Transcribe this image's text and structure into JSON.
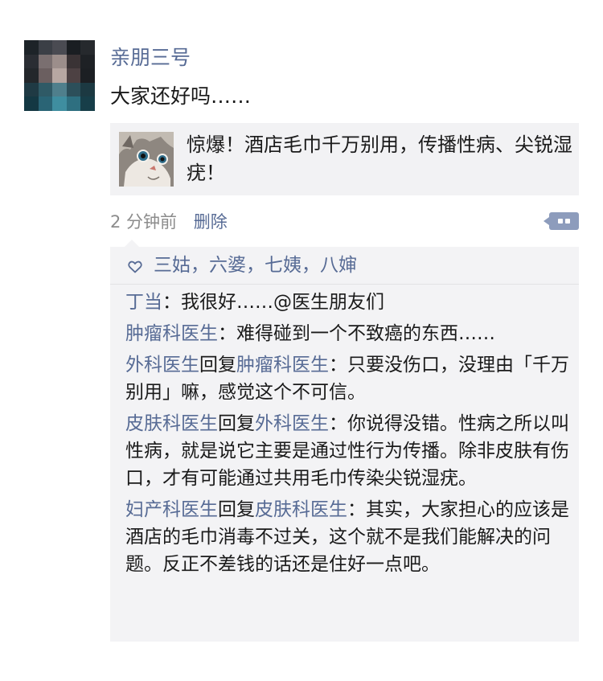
{
  "post": {
    "author": "亲朋三号",
    "text": "大家还好吗……",
    "link_title": "惊爆！酒店毛巾千万别用，传播性病、尖锐湿疣！",
    "time": "2 分钟前",
    "delete_label": "删除"
  },
  "likes": {
    "names": [
      "三姑",
      "六婆",
      "七姨",
      "八婶"
    ],
    "separator": "，"
  },
  "comments": [
    {
      "author": "丁当",
      "reply_word": "",
      "reply_to": "",
      "colon": "：",
      "text": "我很好……@医生朋友们"
    },
    {
      "author": "肿瘤科医生",
      "reply_word": "",
      "reply_to": "",
      "colon": "：",
      "text": "难得碰到一个不致癌的东西……"
    },
    {
      "author": "外科医生",
      "reply_word": "回复",
      "reply_to": "肿瘤科医生",
      "colon": "：",
      "text": "只要没伤口，没理由「千万别用」嘛，感觉这个不可信。"
    },
    {
      "author": "皮肤科医生",
      "reply_word": "回复",
      "reply_to": "外科医生",
      "colon": "：",
      "text": "你说得没错。性病之所以叫性病，就是说它主要是通过性行为传播。除非皮肤有伤口，才有可能通过共用毛巾传染尖锐湿疣。"
    },
    {
      "author": "妇产科医生",
      "reply_word": "回复",
      "reply_to": "皮肤科医生",
      "colon": "：",
      "text": "其实，大家担心的应该是酒店的毛巾消毒不过关，这个就不是我们能解决的问题。反正不差钱的话还是住好一点吧。"
    }
  ],
  "icons": {
    "heart": "heart-outline-icon",
    "comment_button": "more-actions-icon"
  },
  "colors": {
    "link_name": "#576b95",
    "time_gray": "#8c8c8c",
    "comment_button": "#8d9cbc",
    "feedback_bg": "#f3f3f5"
  }
}
